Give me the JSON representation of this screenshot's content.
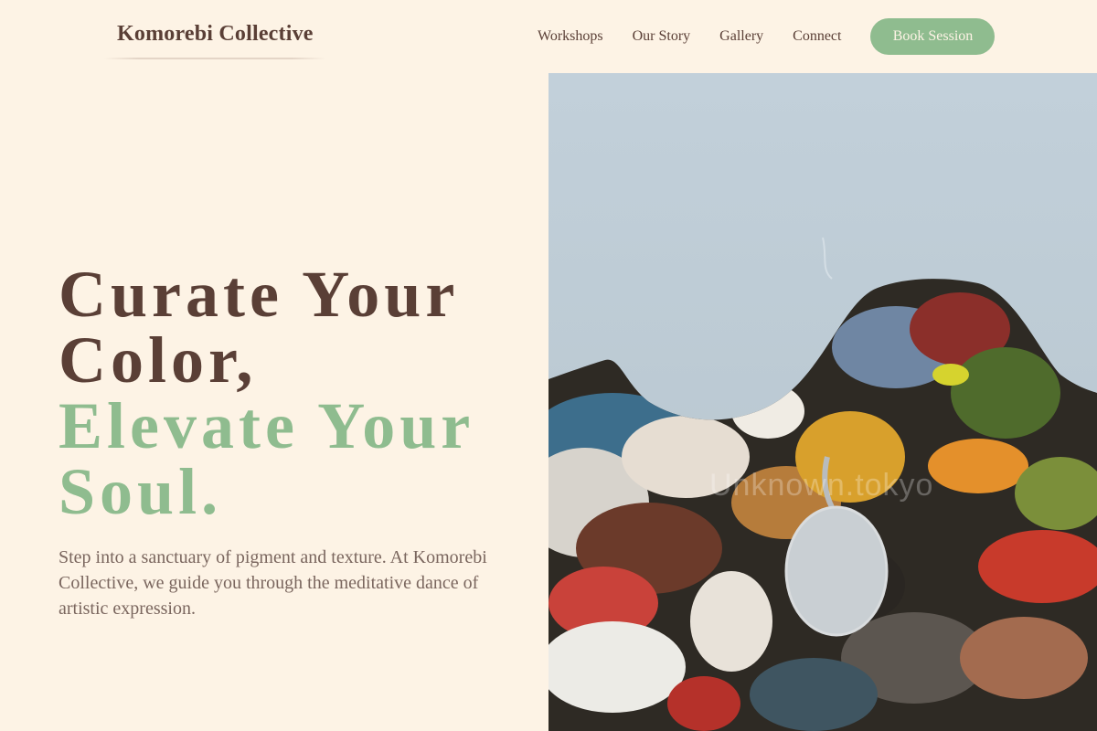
{
  "header": {
    "brand": "Komorebi Collective",
    "nav": [
      "Workshops",
      "Our Story",
      "Gallery",
      "Connect"
    ],
    "cta": "Book Session"
  },
  "hero": {
    "lines": [
      "Curate Your",
      "Color,",
      "Elevate Your",
      "Soul."
    ],
    "description": "Step into a sanctuary of pigment and texture. At Komorebi Collective, we guide you through the meditative dance of artistic expression."
  },
  "image": {
    "watermark": "Unknown.tokyo",
    "subject": "paint-palette-photo"
  },
  "colors": {
    "background": "#fdf3e5",
    "primary_text": "#5a3f36",
    "accent": "#8fbc8f",
    "body_text": "#7a665e"
  }
}
